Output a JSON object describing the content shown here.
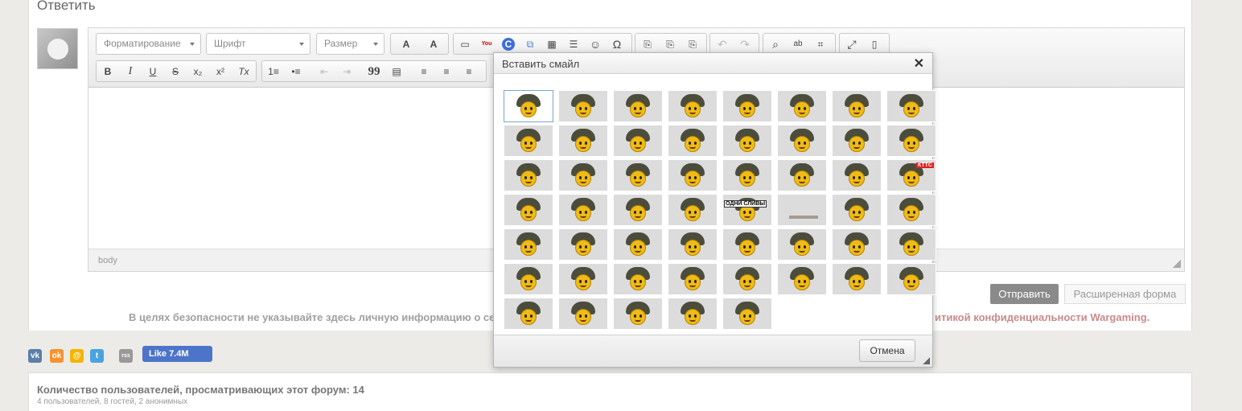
{
  "reply": {
    "title": "Ответить"
  },
  "toolbar": {
    "format_label": "Форматирование",
    "font_label": "Шрифт",
    "size_label": "Размер",
    "btn_bold": "B",
    "btn_italic": "I",
    "btn_underline": "U",
    "btn_strike": "S",
    "btn_subscript": "x₂",
    "btn_superscript": "x²",
    "btn_removeformat": "Tx",
    "btn_numlist": "1≡",
    "btn_bulletlist": "•≡",
    "btn_outdent": "⇤",
    "btn_indent": "⇥",
    "btn_quote": "99",
    "btn_align_left": "≡",
    "btn_align_center": "≡",
    "btn_align_right": "≡",
    "btn_justify": "≡",
    "btn_textcolor": "A",
    "btn_bgcolor": "A",
    "btn_image": "▭",
    "btn_youtube": "You",
    "btn_code": "C",
    "btn_media": "⧉",
    "btn_table": "▦",
    "btn_hr": "☰",
    "btn_smiley": "☺",
    "btn_special": "Ω",
    "btn_cut": "⎘",
    "btn_copy": "⎘",
    "btn_paste": "⎘",
    "btn_undo": "↶",
    "btn_redo": "↷",
    "btn_find": "⌕",
    "btn_replace": "ab",
    "btn_source": "⌗",
    "btn_maximize": "⤢",
    "btn_preview": "▯"
  },
  "editor": {
    "path": "body"
  },
  "actions": {
    "send_label": "Отправить",
    "advanced_label": "Расширенная форма"
  },
  "privacy": {
    "left": "В целях безопасности не указывайте здесь личную информацию о се",
    "right": "итикой конфиденциальности Wargaming."
  },
  "share": {
    "vk": "vk",
    "ok": "ok",
    "mailru": "@",
    "twitter": "t",
    "rss": "rss",
    "like_label": "Like 7.4M"
  },
  "viewers": {
    "title": "Количество пользователей, просматривающих этот форум: 14",
    "subtitle": "4 пользователей, 8 гостей, 2 анонимных"
  },
  "dialog": {
    "title": "Вставить смайл",
    "close": "✕",
    "cancel_label": "Отмена",
    "tags": {
      "ktts": "КТТС",
      "slivy": "ОДНИ СЛИВЫ"
    }
  },
  "colors": {
    "accent": "#7aa5c7",
    "smiley_bg": "#dcdcdc",
    "face": "#f0bb15",
    "helmet": "#4c4c3d",
    "like": "#4c75c9"
  }
}
